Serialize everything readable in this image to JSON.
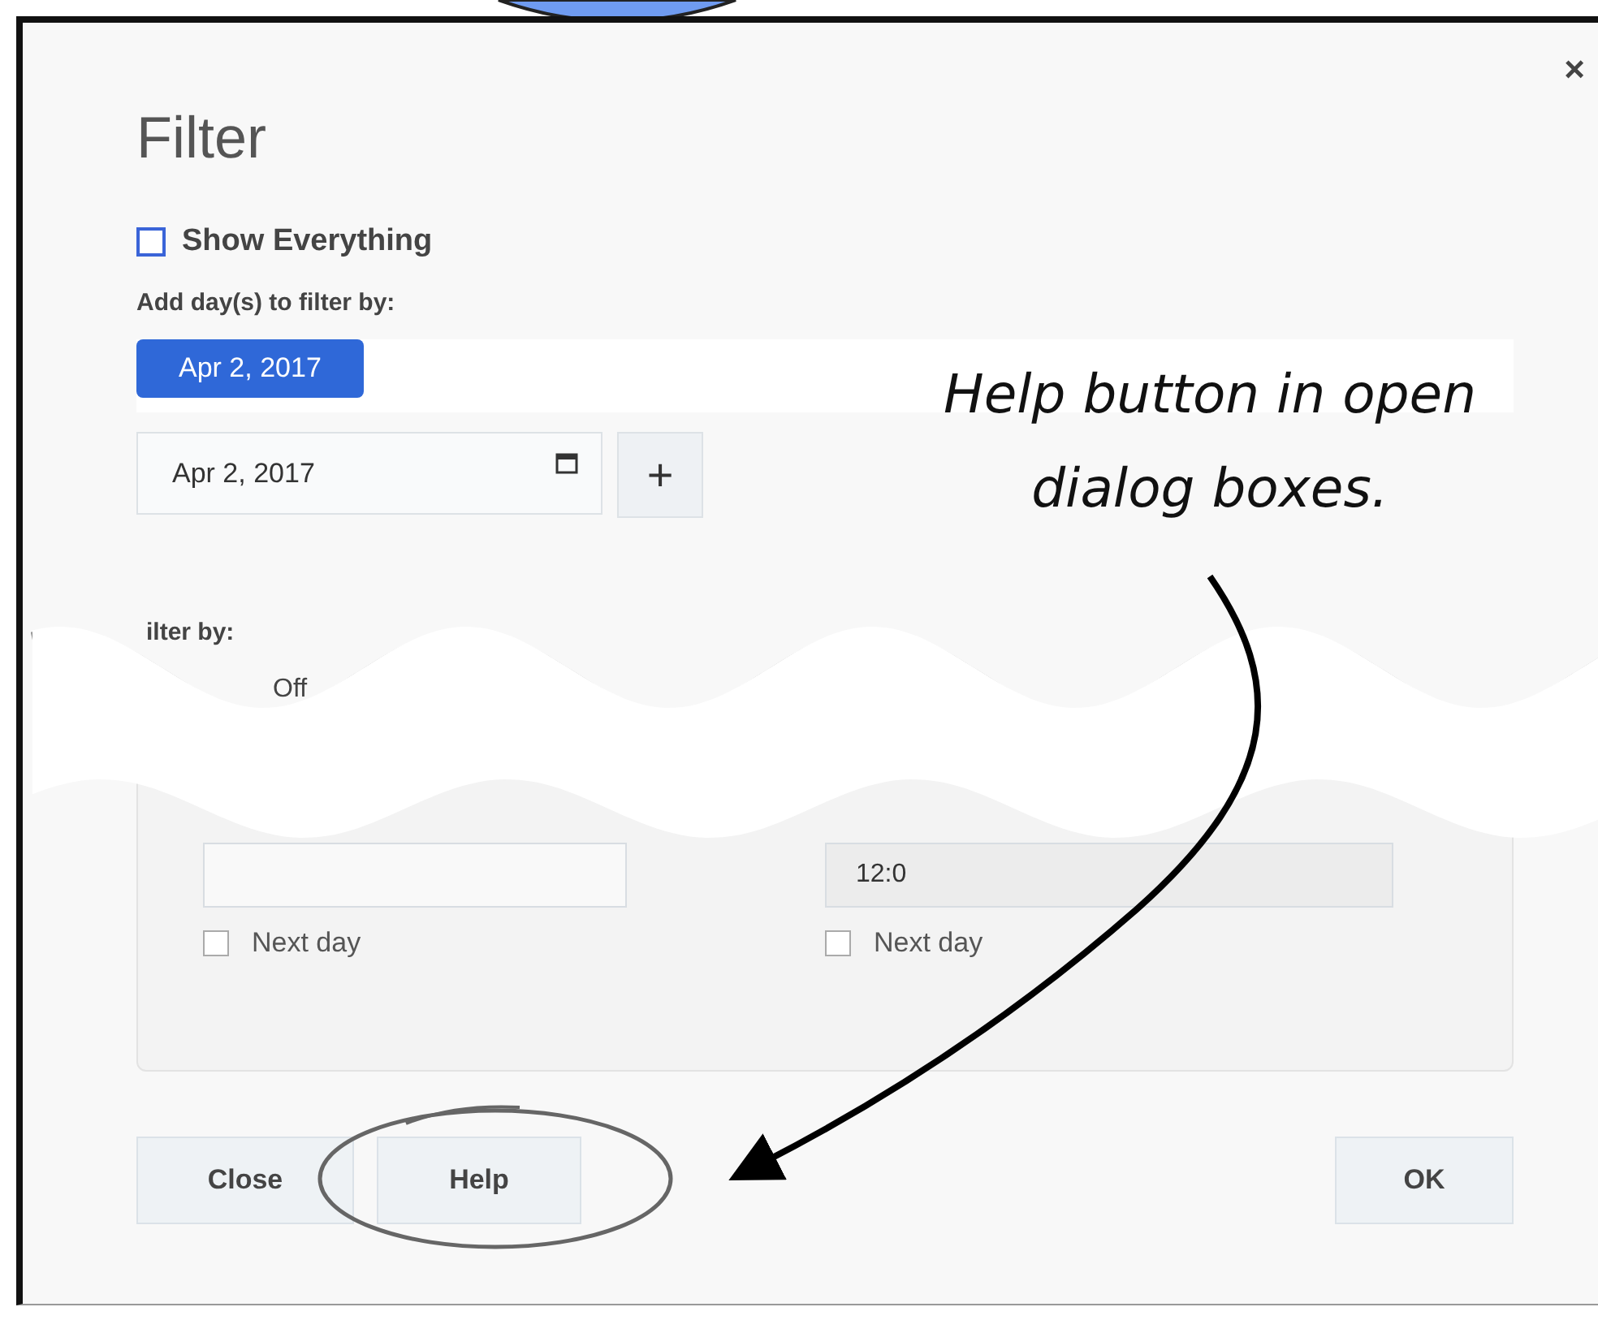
{
  "dialog": {
    "title": "Filter",
    "close_icon": "×",
    "show_everything": {
      "label": "Show Everything",
      "checked": false
    },
    "add_days_label": "Add day(s) to filter by:",
    "selected_days": [
      {
        "label": "Apr 2, 2017"
      }
    ],
    "date_field": {
      "value": "Apr 2, 2017"
    },
    "add_button": "+",
    "filter_by_label": "ilter by:",
    "option_label": "Off",
    "end_time_field": {
      "value": "12:0"
    },
    "next_day": [
      {
        "label": "Next day",
        "checked": false
      },
      {
        "label": "Next day",
        "checked": false
      }
    ],
    "buttons": [
      {
        "label": "Close",
        "circled": false
      },
      {
        "label": "Help",
        "circled": true
      },
      {
        "label": "OK",
        "circled": false
      }
    ]
  },
  "annotation": {
    "lines": [
      "Help button in open",
      "dialog boxes."
    ]
  }
}
